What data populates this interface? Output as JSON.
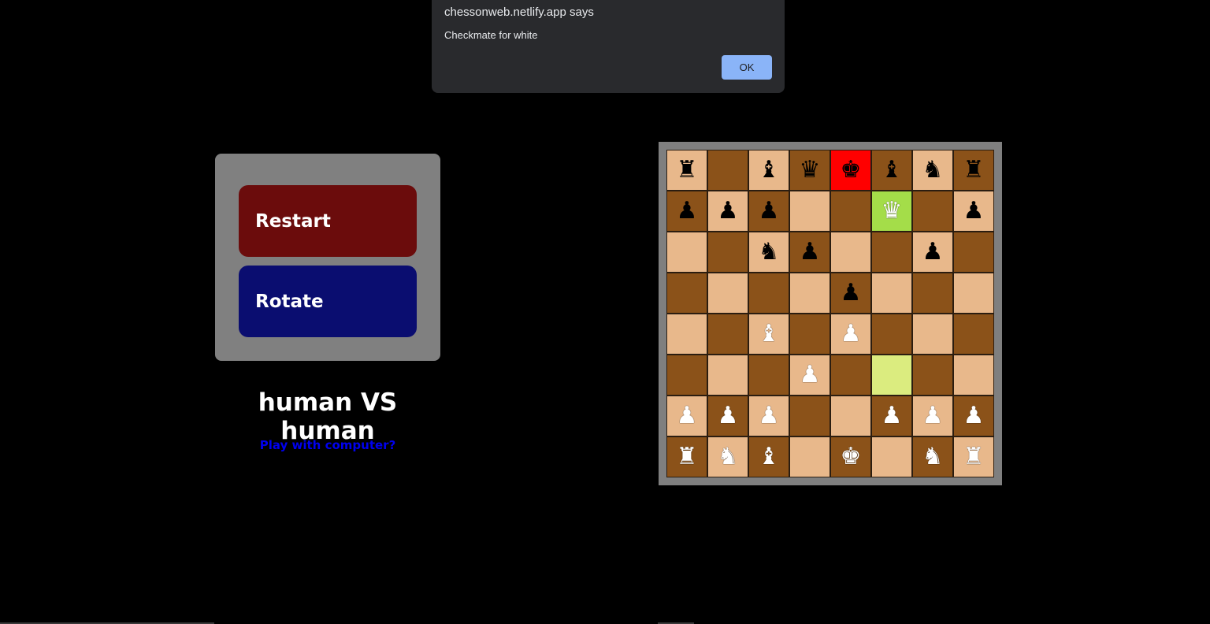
{
  "dialog": {
    "title": "chessonweb.netlify.app says",
    "message": "Checkmate for white",
    "ok_label": "OK"
  },
  "controls": {
    "restart_label": "Restart",
    "rotate_label": "Rotate",
    "restart_color": "#6b0c0c",
    "rotate_color": "#0a0d70"
  },
  "mode_title": "human VS human",
  "play_link": "Play with computer?",
  "board": {
    "light_color": "#e8b88b",
    "dark_color": "#8b5219",
    "check_color": "#ff0000",
    "move_to_color": "#a4dd49",
    "move_from_color": "#dbec7f",
    "ranks": [
      [
        "br",
        "",
        "bb",
        "bq",
        "bk",
        "bb",
        "bn",
        "br"
      ],
      [
        "bp",
        "bp",
        "bp",
        "",
        "",
        "wq",
        "",
        "bp"
      ],
      [
        "",
        "",
        "bn",
        "bp",
        "",
        "",
        "bp",
        ""
      ],
      [
        "",
        "",
        "",
        "",
        "bp",
        "",
        "",
        ""
      ],
      [
        "",
        "",
        "wb",
        "",
        "wp",
        "",
        "",
        ""
      ],
      [
        "",
        "",
        "",
        "wp",
        "",
        "",
        "",
        ""
      ],
      [
        "wp",
        "wp",
        "wp",
        "",
        "",
        "wp",
        "wp",
        "wp"
      ],
      [
        "wr",
        "wn",
        "wb",
        "",
        "wk",
        "",
        "wn",
        "wr"
      ]
    ],
    "highlights": {
      "check": [
        0,
        4
      ],
      "move_to": [
        1,
        5
      ],
      "move_from": [
        5,
        5
      ]
    }
  },
  "piece_icons": {
    "k": "♚",
    "q": "♛",
    "r": "♜",
    "b": "♝",
    "n": "♞",
    "p": "♟"
  }
}
